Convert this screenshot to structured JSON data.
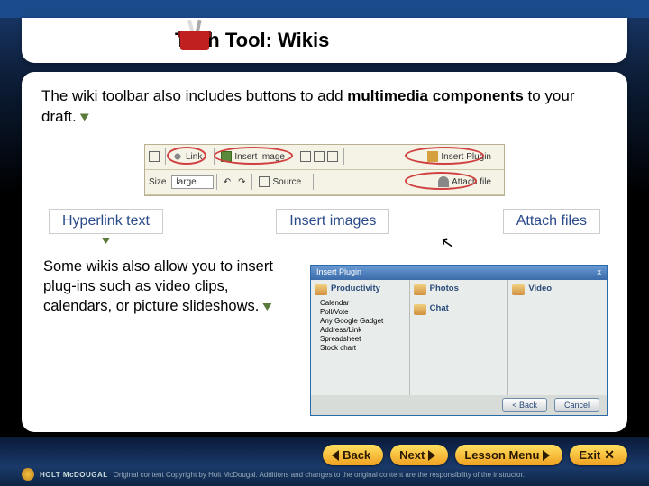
{
  "title": "Tech Tool: Wikis",
  "intro": {
    "pre": "The wiki toolbar also includes buttons to add ",
    "bold": "multimedia components",
    "post": " to your draft."
  },
  "toolbar": {
    "link": "Link",
    "insert_image": "Insert Image",
    "insert_plugin": "Insert Plugin",
    "size_label": "Size",
    "size_value": "large",
    "source": "Source",
    "attach_file": "Attach file"
  },
  "labels": {
    "hyperlink": "Hyperlink text",
    "images": "Insert images",
    "attach": "Attach files"
  },
  "lower_text": "Some wikis also allow you to insert plug-ins such as video clips, calendars, or picture slideshows.",
  "plugin_window": {
    "title": "Insert Plugin",
    "close": "x",
    "col1": {
      "head": "Productivity",
      "items": [
        "Calendar",
        "Poll/Vote",
        "Any Google Gadget",
        "Address/Link",
        "Spreadsheet",
        "Stock chart"
      ]
    },
    "col2": {
      "head": "Photos",
      "item": "Chat"
    },
    "col3": {
      "head": "Video"
    },
    "back": "< Back",
    "cancel": "Cancel"
  },
  "nav": {
    "back": "Back",
    "next": "Next",
    "menu": "Lesson Menu",
    "exit": "Exit"
  },
  "footer": {
    "brand": "HOLT McDOUGAL",
    "copy": "Original content Copyright by Holt McDougal. Additions and changes to the original content are the responsibility of the instructor."
  }
}
